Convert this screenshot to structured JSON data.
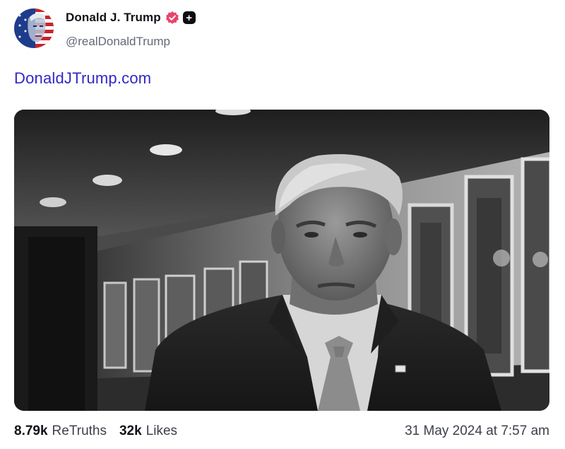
{
  "author": {
    "display_name": "Donald J. Trump",
    "handle": "@realDonaldTrump",
    "avatar_icon": "flag-portrait-avatar",
    "verified_icon": "verified-badge-icon",
    "verified_color": "#e8456b",
    "plus_badge_symbol": "+"
  },
  "post": {
    "link_text": "DonaldJTrump.com",
    "link_color": "#3227c8",
    "media_icon": "video-thumbnail"
  },
  "stats": {
    "retruths_count": "8.79k",
    "retruths_label": "ReTruths",
    "likes_count": "32k",
    "likes_label": "Likes",
    "timestamp": "31 May 2024 at 7:57 am"
  }
}
